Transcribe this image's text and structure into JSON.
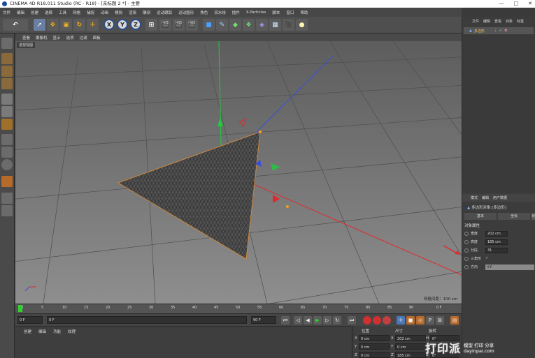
{
  "window": {
    "title": "CINEMA 4D R18.011 Studio (RC - R18) - [未标题 2 *] - 主要",
    "minimize": "—",
    "maximize": "□",
    "close": "✕"
  },
  "menubar": [
    "文件",
    "编辑",
    "创建",
    "选择",
    "工具",
    "网格",
    "捕捉",
    "动画",
    "模拟",
    "渲染",
    "雕刻",
    "运动跟踪",
    "运动图形",
    "角色",
    "流水线",
    "插件",
    "X-Particles",
    "脚本",
    "窗口",
    "帮助"
  ],
  "toolbar": {
    "axis_x": "X",
    "axis_y": "Y",
    "axis_z": "Z",
    "icons": [
      "undo-icon",
      "select-icon",
      "move-icon",
      "scale-icon",
      "rotate-icon",
      "last-tool-icon",
      "render-icon",
      "cube-icon",
      "pen-icon",
      "generator-icon",
      "deformer-icon",
      "scene-icon",
      "camera-icon",
      "light-icon"
    ]
  },
  "viewport": {
    "menu": [
      "查看",
      "摄像机",
      "显示",
      "选项",
      "过滤",
      "面板"
    ],
    "label": "透视视图",
    "grid_spacing": "网格间距：100 cm",
    "colors": {
      "mesh": "#3c3c3c",
      "wire": "#6a6a6a",
      "axis_x": "#e02b2b",
      "axis_y": "#1fcc3b",
      "axis_z": "#3b4fd9"
    }
  },
  "timeline": {
    "ticks": [
      "0",
      "5",
      "10",
      "15",
      "20",
      "25",
      "30",
      "35",
      "40",
      "45",
      "50",
      "55",
      "60",
      "65",
      "70",
      "75",
      "80",
      "85",
      "90"
    ],
    "end_frame": "0 F"
  },
  "transport": {
    "start": "0 F",
    "current": "0 F",
    "end": "90 F",
    "max": "90 F"
  },
  "bottom_left": {
    "menu": [
      "创建",
      "编辑",
      "功能",
      "纹理"
    ]
  },
  "coords": {
    "headers": [
      "位置",
      "尺寸",
      "旋转"
    ],
    "rows": [
      {
        "axis": "X",
        "pos": "0 cm",
        "size_axis": "X",
        "size": "202 cm",
        "rot_axis": "H",
        "rot": "0°"
      },
      {
        "axis": "Y",
        "pos": "0 cm",
        "size_axis": "Y",
        "size": "0 cm",
        "rot_axis": "P",
        "rot": "0°"
      },
      {
        "axis": "Z",
        "pos": "0 cm",
        "size_axis": "Z",
        "size": "185 cm",
        "rot_axis": "B",
        "rot": "0°"
      }
    ]
  },
  "object_manager": {
    "menu": [
      "文件",
      "编辑",
      "查看",
      "对象",
      "标签"
    ],
    "object_name": "多边形"
  },
  "attributes": {
    "menu": [
      "模式",
      "编辑",
      "用户数据"
    ],
    "title": "多边形对象 [多边形]",
    "tabs": [
      "基本",
      "坐标",
      "对象"
    ],
    "section": "对象属性",
    "props": [
      {
        "label": "宽度",
        "value": "202 cm"
      },
      {
        "label": "高度",
        "value": "185 cm"
      },
      {
        "label": "分段",
        "value": "31"
      },
      {
        "label": "三角形",
        "value": "✓"
      },
      {
        "label": "方向",
        "value": "+Y"
      }
    ]
  },
  "watermark": {
    "big": "打印派",
    "line1": "模型 打印 分享",
    "line2": "dayinpai.com"
  }
}
